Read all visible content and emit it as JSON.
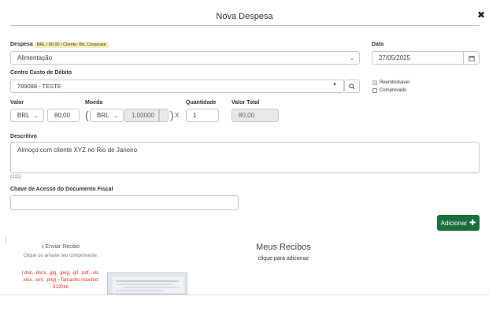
{
  "modal": {
    "title": "Nova Despesa",
    "close_icon": "close-icon"
  },
  "despesa": {
    "label": "Despesa",
    "badge": "BRL / 80,00 / Cliente: BrL Corporate",
    "value": "Alimentação"
  },
  "data": {
    "label": "Data",
    "value": "27/05/2025",
    "icon": "calendar-icon"
  },
  "centro_custo": {
    "label": "Centro Custo de Débito",
    "value": "789088 - TESTE",
    "icon": "search-icon"
  },
  "checkboxes": {
    "reembolsavel": "Reembolsável",
    "comprovado": "Comprovado"
  },
  "valor": {
    "label": "Valor",
    "currency": "BRL",
    "amount": "80,00"
  },
  "moeda": {
    "label": "Moeda",
    "currency": "BRL",
    "rate": "1,00000",
    "times": "X"
  },
  "quantidade": {
    "label": "Quantidade",
    "value": "1"
  },
  "valor_total": {
    "label": "Valor Total",
    "value": "80,00"
  },
  "descritivo": {
    "label": "Descritivo",
    "value": "Almoço com cliente XYZ no Rio de Janeiro",
    "count": "(215)"
  },
  "chave": {
    "label": "Chave de Acesso do Documento Fiscal",
    "value": ""
  },
  "add_button": {
    "label": "Adicionar",
    "icon": "plus-icon"
  },
  "recibo": {
    "upload_label": "Enviar Recibo",
    "upload_icon": "upload-icon",
    "hint": "Clique ou arraste seu comprovante.",
    "formats": "(.doc, .docx, .jpg, .jpeg, .gif, .pdf, .xls, .xlsx, .xml, .png) - Tamanho máximo: 5120kb",
    "title": "Meus Recibos",
    "subtitle": "clique para adicionar"
  },
  "colors": {
    "accent_green": "#1c6f3a",
    "badge_yellow": "#fbeeb5",
    "error_red": "#e0342b"
  }
}
